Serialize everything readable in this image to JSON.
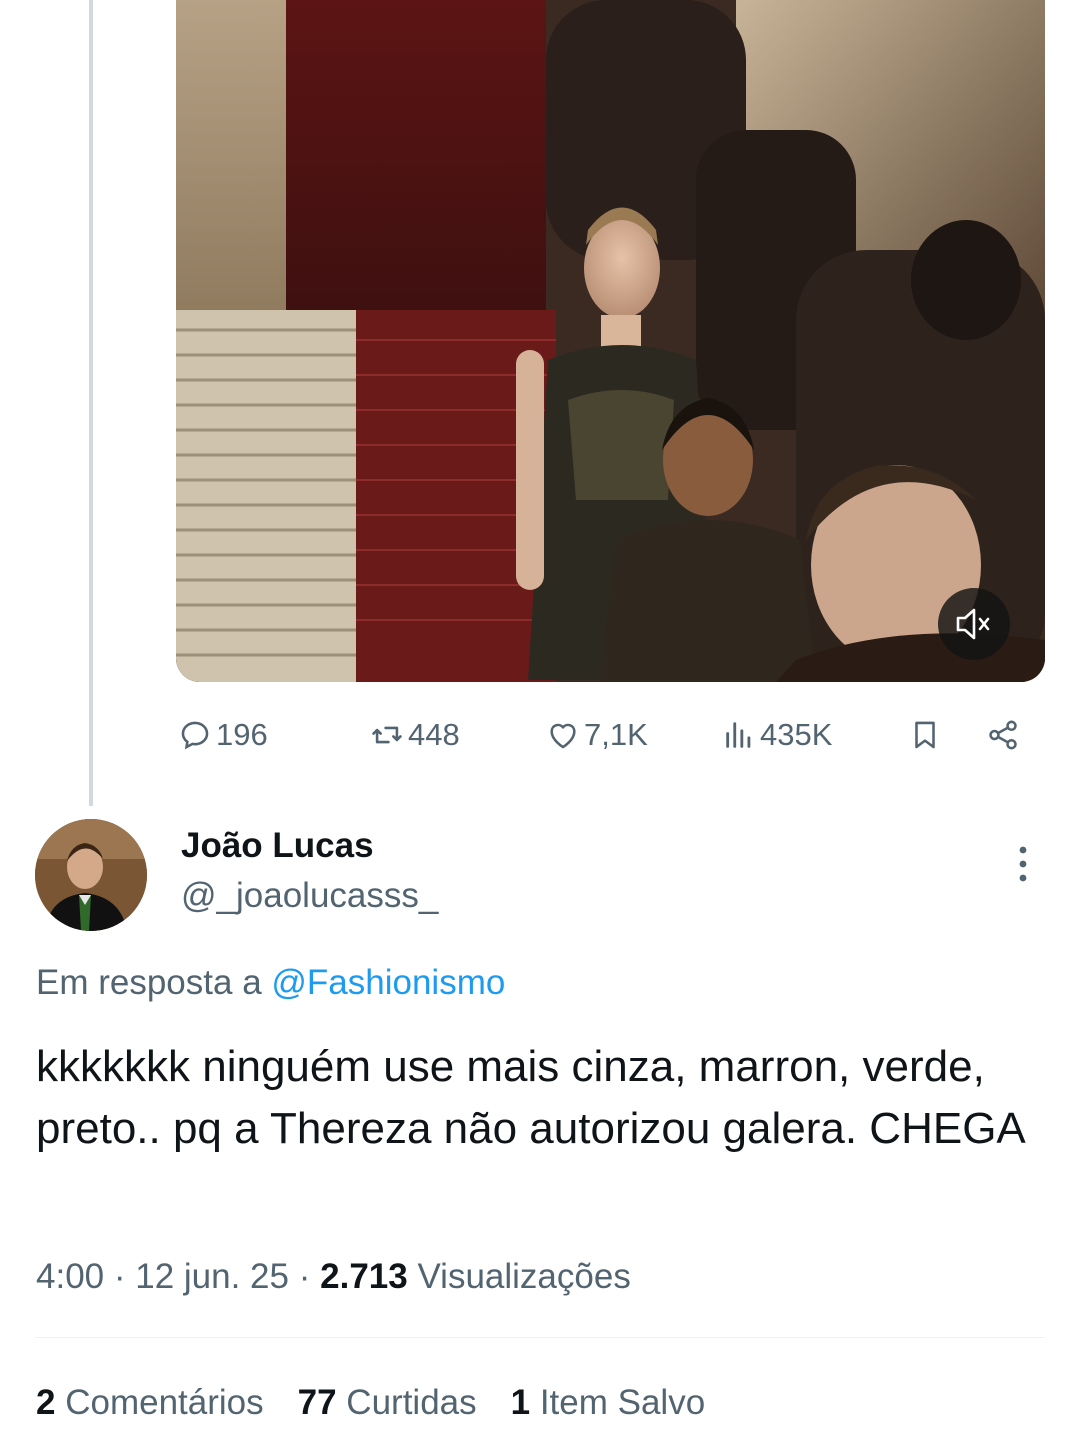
{
  "tweet": {
    "media": {
      "muted_icon": "speaker-muted-icon"
    },
    "actions": {
      "replies": "196",
      "reposts": "448",
      "likes": "7,1K",
      "views": "435K",
      "icons": [
        "reply-icon",
        "repost-icon",
        "like-icon",
        "views-icon",
        "bookmark-icon",
        "share-icon"
      ]
    }
  },
  "reply": {
    "display_name": "João Lucas",
    "handle": "@_joaolucasss_",
    "in_reply_prefix": "Em resposta a",
    "in_reply_mention": "@Fashionismo",
    "text": "kkkkkkk ninguém use mais cinza, marron, verde, preto.. pq a Thereza não autorizou galera. CHEGA",
    "time": "4:00",
    "sep": "·",
    "date": "12 jun. 25",
    "views_count": "2.713",
    "views_label": "Visualizações",
    "stats": {
      "comments_count": "2",
      "comments_label": "Comentários",
      "likes_count": "77",
      "likes_label": "Curtidas",
      "saves_count": "1",
      "saves_label": "Item Salvo"
    }
  },
  "colors": {
    "text": "#0f1419",
    "secondary": "#536471",
    "link": "#1d9bf0",
    "thread_line": "#cfd9de"
  }
}
